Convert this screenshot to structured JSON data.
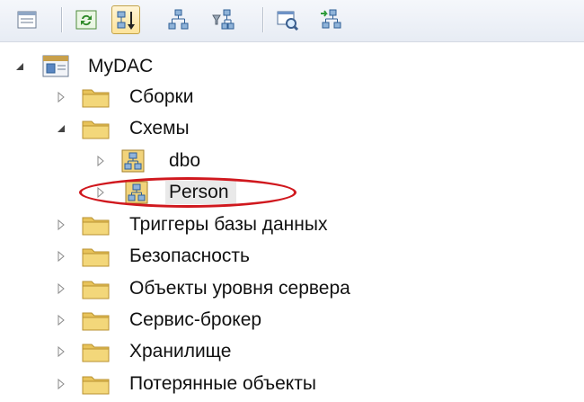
{
  "toolbar": {
    "buttons": [
      {
        "icon": "properties-icon"
      },
      {
        "icon": "refresh-icon"
      },
      {
        "icon": "sort-icon",
        "active": true
      },
      {
        "icon": "schema-icon"
      },
      {
        "icon": "filter-icon"
      },
      {
        "icon": "find-icon"
      },
      {
        "icon": "sync-icon"
      }
    ]
  },
  "tree": {
    "root": {
      "label": "MyDAC",
      "icon": "database-icon",
      "expanded": true
    },
    "items": [
      {
        "label": "Сборки",
        "icon": "folder-icon",
        "expanded": false
      },
      {
        "label": "Схемы",
        "icon": "folder-icon",
        "expanded": true,
        "children": [
          {
            "label": "dbo",
            "icon": "schema-icon",
            "expanded": false
          },
          {
            "label": "Person",
            "icon": "schema-icon",
            "expanded": false,
            "selected": true
          }
        ]
      },
      {
        "label": "Триггеры базы данных",
        "icon": "folder-icon",
        "expanded": false
      },
      {
        "label": "Безопасность",
        "icon": "folder-icon",
        "expanded": false
      },
      {
        "label": "Объекты уровня сервера",
        "icon": "folder-icon",
        "expanded": false
      },
      {
        "label": "Сервис-брокер",
        "icon": "folder-icon",
        "expanded": false
      },
      {
        "label": "Хранилище",
        "icon": "folder-icon",
        "expanded": false
      },
      {
        "label": "Потерянные объекты",
        "icon": "folder-icon",
        "expanded": false
      }
    ]
  },
  "colors": {
    "highlight": "#d0181e",
    "folder": "#e8c35a"
  }
}
